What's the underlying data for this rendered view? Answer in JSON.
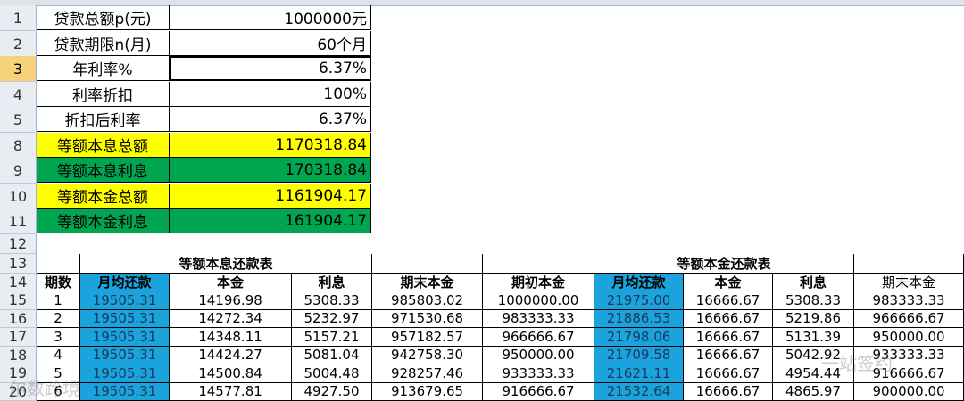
{
  "summary": [
    {
      "row": "1",
      "label": "贷款总额p(元)",
      "value": "1000000元"
    },
    {
      "row": "2",
      "label": "贷款期限n(月)",
      "value": "60个月"
    },
    {
      "row": "3",
      "label": "年利率%",
      "value": "6.37%"
    },
    {
      "row": "4",
      "label": "利率折扣",
      "value": "100%"
    },
    {
      "row": "5",
      "label": "折扣后利率",
      "value": "6.37%"
    },
    {
      "row": "8",
      "label": "等额本息总额",
      "value": "1170318.84"
    },
    {
      "row": "9",
      "label": "等额本息利息",
      "value": "170318.84"
    },
    {
      "row": "10",
      "label": "等额本金总额",
      "value": "1161904.17"
    },
    {
      "row": "11",
      "label": "等额本金利息",
      "value": "161904.17"
    }
  ],
  "row12": "12",
  "row13": "13",
  "row14": "14",
  "table_titles": {
    "equal_installment": "等额本息还款表",
    "equal_principal": "等额本金还款表"
  },
  "headers": [
    "期数",
    "月均还款",
    "本金",
    "利息",
    "期末本金",
    "期初本金",
    "月均还款",
    "本金",
    "利息",
    "期末本金"
  ],
  "rows": [
    {
      "rownum": "15",
      "cells": [
        "1",
        "19505.31",
        "14196.98",
        "5308.33",
        "985803.02",
        "1000000.00",
        "21975.00",
        "16666.67",
        "5308.33",
        "983333.33"
      ]
    },
    {
      "rownum": "16",
      "cells": [
        "2",
        "19505.31",
        "14272.34",
        "5232.97",
        "971530.68",
        "983333.33",
        "21886.53",
        "16666.67",
        "5219.86",
        "966666.67"
      ]
    },
    {
      "rownum": "17",
      "cells": [
        "3",
        "19505.31",
        "14348.11",
        "5157.21",
        "957182.57",
        "966666.67",
        "21798.06",
        "16666.67",
        "5131.39",
        "950000.00"
      ]
    },
    {
      "rownum": "18",
      "cells": [
        "4",
        "19505.31",
        "14424.27",
        "5081.04",
        "942758.30",
        "950000.00",
        "21709.58",
        "16666.67",
        "5042.92",
        "933333.33"
      ]
    },
    {
      "rownum": "19",
      "cells": [
        "5",
        "19505.31",
        "14500.84",
        "5004.48",
        "928257.46",
        "933333.33",
        "21621.11",
        "16666.67",
        "4954.44",
        "916666.67"
      ]
    },
    {
      "rownum": "20",
      "cells": [
        "6",
        "19505.31",
        "14577.81",
        "4927.50",
        "913679.65",
        "916666.67",
        "21532.64",
        "16666.67",
        "4865.97",
        "900000.00"
      ]
    }
  ],
  "watermarks": {
    "left": "尔数跨境",
    "right": "一站签约"
  },
  "colors": {
    "yellow": "#ffff00",
    "green": "#00a550",
    "blue": "#1aa3dd",
    "selected_row_header": "#f6d37a"
  }
}
